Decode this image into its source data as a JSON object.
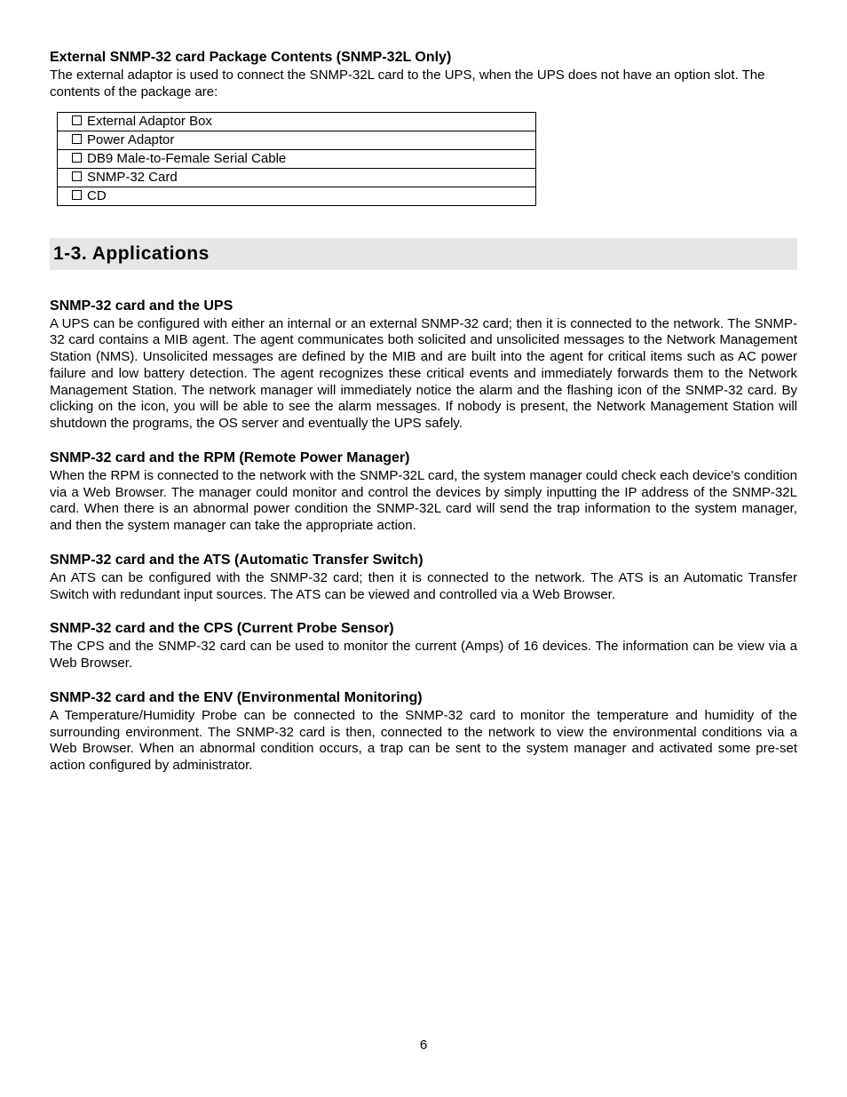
{
  "package": {
    "heading": "External SNMP-32 card Package Contents (SNMP-32L Only)",
    "intro": "The external adaptor is used to connect the SNMP-32L card to the UPS, when the UPS does not have an option slot.  The contents of the package are:",
    "items": [
      "External Adaptor Box",
      "Power Adaptor",
      "DB9 Male-to-Female Serial Cable",
      "SNMP-32 Card",
      "CD"
    ]
  },
  "sectionHeading": "1-3.  Applications",
  "subsections": [
    {
      "title": "SNMP-32 card and the UPS",
      "body": "A UPS can be configured with either an internal or an external SNMP-32 card; then it is connected to the network.  The SNMP-32 card contains a MIB agent.  The agent communicates both solicited and unsolicited messages to the Network Management Station (NMS).  Unsolicited messages are defined by the MIB and are built into the agent for critical items such as AC power failure and low battery detection.  The agent recognizes these critical events and immediately forwards them to the Network Management Station.  The network manager will immediately notice the alarm and the flashing icon of the SNMP-32 card.  By clicking on the icon, you will be able to see the alarm messages.  If nobody is present, the Network Management Station will shutdown the programs, the OS server and eventually the UPS safely."
    },
    {
      "title": "SNMP-32 card and the RPM (Remote Power Manager)",
      "body": "When the RPM is connected to the network with the SNMP-32L card, the system manager could check each device's condition via a Web Browser.  The manager could monitor and control the devices by simply inputting the IP address of the SNMP-32L card.  When there is an abnormal power condition the SNMP-32L card will send the trap information to the system manager, and then the system manager can take the appropriate action."
    },
    {
      "title": "SNMP-32 card and the ATS (Automatic Transfer Switch)",
      "body": "An ATS can be configured with the SNMP-32 card; then it is connected to the network.  The ATS is an Automatic Transfer Switch with redundant input sources.  The ATS can be viewed and controlled via a Web Browser."
    },
    {
      "title": "SNMP-32 card and the CPS (Current Probe Sensor)",
      "body": "The CPS and the SNMP-32 card can be used to monitor the current (Amps) of 16 devices.  The information can be view via a Web Browser."
    },
    {
      "title": "SNMP-32 card and the ENV (Environmental Monitoring)",
      "body": "A Temperature/Humidity Probe can be connected to the SNMP-32 card to monitor the temperature and humidity of the surrounding environment.  The SNMP-32 card is then, connected to the network to view the environmental conditions via a Web Browser.  When an abnormal condition occurs, a trap can be sent to the system manager and activated some pre-set action configured by administrator."
    }
  ],
  "pageNumber": "6"
}
